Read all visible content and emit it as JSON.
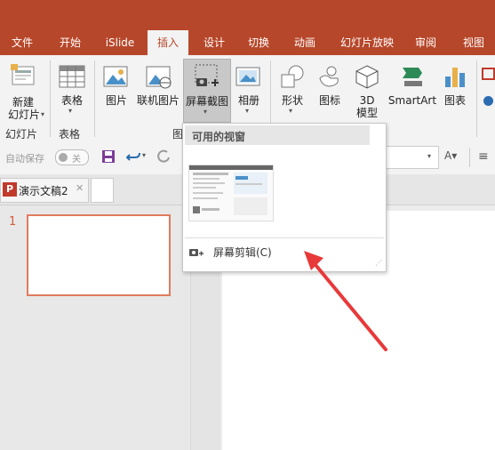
{
  "tabs": [
    {
      "label": "文件"
    },
    {
      "label": "开始"
    },
    {
      "label": "iSlide"
    },
    {
      "label": "插入"
    },
    {
      "label": "设计"
    },
    {
      "label": "切换"
    },
    {
      "label": "动画"
    },
    {
      "label": "幻灯片放映"
    },
    {
      "label": "审阅"
    },
    {
      "label": "视图"
    }
  ],
  "ribbon": {
    "new_slide_line1": "新建",
    "new_slide_line2": "幻灯片",
    "table": "表格",
    "picture": "图片",
    "online_picture": "联机图片",
    "screenshot": "屏幕截图",
    "album": "相册",
    "shapes": "形状",
    "icons": "图标",
    "model3d_line1": "3D",
    "model3d_line2": "模型",
    "smartart": "SmartArt",
    "chart": "图表",
    "group_slides": "幻灯片",
    "group_tables": "表格",
    "group_images_partial": "图"
  },
  "qat": {
    "autosave": "自动保存",
    "toggle_state": "关"
  },
  "doc_tab": {
    "title": "演示文稿2"
  },
  "slides": {
    "number": "1"
  },
  "dropdown": {
    "header": "可用的视窗",
    "screen_clipping": "屏幕剪辑(C)"
  },
  "colors": {
    "brand": "#b7472a",
    "selected_slide_border": "#e07b5f",
    "arrow": "#e8393a"
  }
}
